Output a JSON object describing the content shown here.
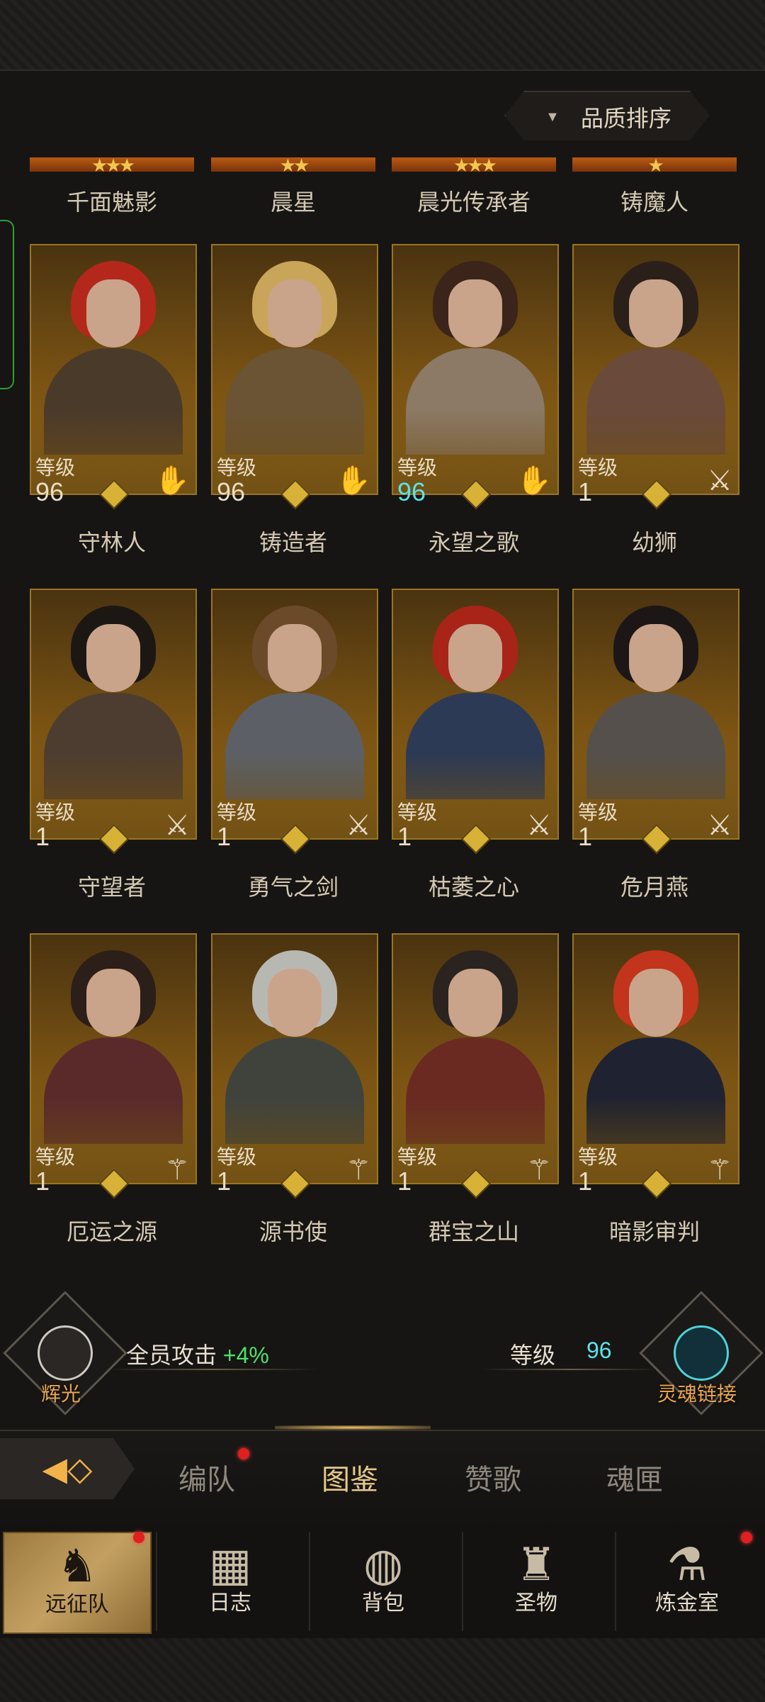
{
  "sort": {
    "label": "品质排序",
    "icon": "triangle-down-icon"
  },
  "top_row": [
    {
      "name": "千面魅影",
      "stars": "★★★"
    },
    {
      "name": "晨星",
      "stars": "★★"
    },
    {
      "name": "晨光传承者",
      "stars": "★★★"
    },
    {
      "name": "铸魔人",
      "stars": "★"
    }
  ],
  "heroes": [
    {
      "name": "守林人",
      "level_label": "等级",
      "level": "96",
      "level_color": "#e9ddc6",
      "class_icon": "hand-icon",
      "hair": "#b3281a",
      "body": "#4a3a2a"
    },
    {
      "name": "铸造者",
      "level_label": "等级",
      "level": "96",
      "level_color": "#e9ddc6",
      "class_icon": "hand-icon",
      "hair": "#c9a55a",
      "body": "#6b5434"
    },
    {
      "name": "永望之歌",
      "level_label": "等级",
      "level": "96",
      "level_color": "#5be3ea",
      "class_icon": "hand-icon",
      "hair": "#3b2419",
      "body": "#8c7a66"
    },
    {
      "name": "幼狮",
      "level_label": "等级",
      "level": "1",
      "level_color": "#e9ddc6",
      "class_icon": "sword-icon",
      "hair": "#2a1f19",
      "body": "#6a4a3a"
    },
    {
      "name": "守望者",
      "level_label": "等级",
      "level": "1",
      "level_color": "#e9ddc6",
      "class_icon": "sword-icon",
      "hair": "#1d1714",
      "body": "#4d3d30"
    },
    {
      "name": "勇气之剑",
      "level_label": "等级",
      "level": "1",
      "level_color": "#e9ddc6",
      "class_icon": "sword-icon",
      "hair": "#6b4a2a",
      "body": "#5c6066"
    },
    {
      "name": "枯萎之心",
      "level_label": "等级",
      "level": "1",
      "level_color": "#e9ddc6",
      "class_icon": "sword-icon",
      "hair": "#a82418",
      "body": "#2c3a55"
    },
    {
      "name": "危月燕",
      "level_label": "等级",
      "level": "1",
      "level_color": "#e9ddc6",
      "class_icon": "sword-icon",
      "hair": "#1c1616",
      "body": "#55504c"
    },
    {
      "name": "厄运之源",
      "level_label": "等级",
      "level": "1",
      "level_color": "#e9ddc6",
      "class_icon": "staff-icon",
      "hair": "#2c1e18",
      "body": "#5a2a2a"
    },
    {
      "name": "源书使",
      "level_label": "等级",
      "level": "1",
      "level_color": "#e9ddc6",
      "class_icon": "staff-icon",
      "hair": "#b8b8b2",
      "body": "#3f433c"
    },
    {
      "name": "群宝之山",
      "level_label": "等级",
      "level": "1",
      "level_color": "#e9ddc6",
      "class_icon": "staff-icon",
      "hair": "#2a2320",
      "body": "#6a2a22"
    },
    {
      "name": "暗影审判",
      "level_label": "等级",
      "level": "1",
      "level_color": "#e9ddc6",
      "class_icon": "staff-icon",
      "hair": "#c2341c",
      "body": "#1f2230"
    }
  ],
  "bonus": {
    "left_label": "辉光",
    "stat_text": "全员攻击",
    "stat_value": "+4%",
    "level_label": "等级",
    "level_value": "96",
    "right_label": "灵魂链接"
  },
  "tabs": [
    {
      "label": "编队",
      "badge": true
    },
    {
      "label": "图鉴",
      "active": true
    },
    {
      "label": "赞歌"
    },
    {
      "label": "魂匣"
    }
  ],
  "nav": [
    {
      "label": "远征队",
      "icon": "helmet-icon",
      "active": true,
      "badge": true
    },
    {
      "label": "日志",
      "icon": "scroll-icon"
    },
    {
      "label": "背包",
      "icon": "bag-icon"
    },
    {
      "label": "圣物",
      "icon": "relic-icon"
    },
    {
      "label": "炼金室",
      "icon": "alchemy-icon",
      "badge": true
    }
  ],
  "colors": {
    "accent_gold": "#d7b236",
    "cyan": "#5be3ea",
    "green": "#4ee06b",
    "badge_red": "#e01f1f",
    "tab_active": "#e6c989"
  }
}
